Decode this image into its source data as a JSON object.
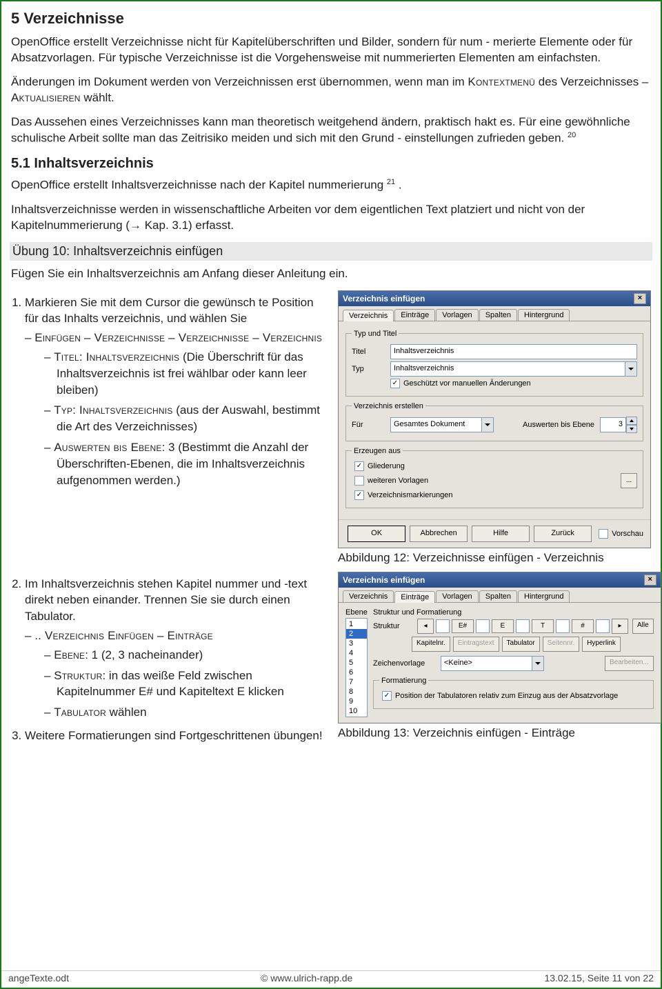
{
  "h1": "5    Verzeichnisse",
  "p1": "OpenOffice erstellt Verzeichnisse nicht für Kapitelüberschriften und Bilder, sondern für num - merierte Elemente oder für Absatzvorlagen. Für typische Verzeichnisse ist die Vorgehensweise mit nummerierten Elementen am einfachsten.",
  "p2a": "Änderungen im Dokument werden von Verzeichnissen erst übernommen, wenn man im ",
  "p2b": "Kontextmenü",
  "p2c": " des Verzeichnisses – ",
  "p2d": "Aktualisieren",
  "p2e": " wählt.",
  "p3": "Das Aussehen eines Verzeichnisses kann man theoretisch weitgehend ändern, praktisch hakt es. Für eine gewöhnliche schulische Arbeit sollte man das Zeitrisiko meiden und sich mit den Grund - einstellungen zufrieden geben.",
  "fn20": "20",
  "h2": "5.1   Inhaltsverzeichnis",
  "p4a": "OpenOffice erstellt Inhaltsverzeichnisse nach der Kapitel nummerierung",
  "fn21": "21",
  "p4b": ".",
  "p5": "Inhaltsverzeichnisse werden in wissenschaftliche Arbeiten vor dem eigentlichen Text platziert und nicht von der Kapitelnummerierung (→ Kap.  3.1) erfasst.",
  "exercise": "Übung 10: Inhaltsverzeichnis einfügen",
  "p6": "Fügen Sie ein Inhaltsverzeichnis am Anfang dieser Anleitung ein.",
  "li1": "Markieren Sie mit dem Cursor die gewünsch te Position für das Inhalts verzeichnis, und wählen Sie",
  "li1a_pre": "Einfügen – Verzeichnisse – Verzeichnisse – Verzeichnis",
  "li1a1_sc": "Titel: Inhaltsverzeichnis",
  "li1a1_rest": " (Die Überschrift für das Inhaltsverzeichnis ist frei wählbar oder kann leer bleiben)",
  "li1a2_sc": "Typ: Inhaltsverzeichnis",
  "li1a2_rest": " (aus der Auswahl, bestimmt die Art des Verzeichnisses)",
  "li1a3_sc": "Auswerten bis Ebene",
  "li1a3_rest": ": 3 (Bestimmt die Anzahl der Überschriften-Ebenen, die im Inhaltsverzeichnis aufgenommen werden.)",
  "caption1": "Abbildung 12: Verzeichnisse einfügen - Verzeichnis",
  "li2": "Im Inhaltsverzeichnis stehen Kapitel nummer und -text direkt neben einander. Trennen Sie sie durch einen Tabulator.",
  "li2a_pre": ".. Verzeichnis Einfügen – Einträge",
  "li2a1_sc": "Ebene",
  "li2a1_rest": ": 1 (2, 3 nacheinander)",
  "li2a2_sc": "Struktur",
  "li2a2_rest": ": in das weiße Feld zwischen Kapitelnummer E# und Kapiteltext E klicken",
  "li2a3_sc": "Tabulator",
  "li2a3_rest": " wählen",
  "li3": "Weitere Formatierungen sind Fortgeschrittenen übungen!",
  "caption2": "Abbildung 13: Verzeichnis einfügen - Einträge",
  "dlg": {
    "title": "Verzeichnis einfügen",
    "tabs": [
      "Verzeichnis",
      "Einträge",
      "Vorlagen",
      "Spalten",
      "Hintergrund"
    ],
    "grp1": "Typ und Titel",
    "lbl_titel": "Titel",
    "val_titel": "Inhaltsverzeichnis",
    "lbl_typ": "Typ",
    "val_typ": "Inhaltsverzeichnis",
    "chk_protect": "Geschützt vor manuellen Änderungen",
    "grp2": "Verzeichnis erstellen",
    "lbl_fuer": "Für",
    "val_fuer": "Gesamtes Dokument",
    "lbl_level": "Auswerten bis Ebene",
    "val_level": "3",
    "grp3": "Erzeugen aus",
    "chk_outline": "Gliederung",
    "chk_templates": "weiteren Vorlagen",
    "chk_marks": "Verzeichnismarkierungen",
    "btn_ok": "OK",
    "btn_cancel": "Abbrechen",
    "btn_help": "Hilfe",
    "btn_back": "Zurück",
    "chk_preview": "Vorschau"
  },
  "dlg2": {
    "title": "Verzeichnis einfügen",
    "tabs": [
      "Verzeichnis",
      "Einträge",
      "Vorlagen",
      "Spalten",
      "Hintergrund"
    ],
    "lbl_ebene": "Ebene",
    "lbl_struct": "Struktur und Formatierung",
    "lbl_struktur": "Struktur",
    "levels": [
      "1",
      "2",
      "3",
      "4",
      "5",
      "6",
      "7",
      "8",
      "9",
      "10"
    ],
    "sel_level": "2",
    "boxes": [
      "E#",
      "E",
      "T",
      "#"
    ],
    "btn_all": "Alle",
    "btns": [
      "Kapitelnr.",
      "Eintragstext",
      "Tabulator",
      "Seitennr.",
      "Hyperlink"
    ],
    "lbl_charstyle": "Zeichenvorlage",
    "val_charstyle": "<Keine>",
    "btn_edit": "Bearbeiten...",
    "grp_fmt": "Formatierung",
    "chk_tabpos": "Position der Tabulatoren relativ zum Einzug aus der Absatzvorlage"
  },
  "footer": {
    "left": "angeTexte.odt",
    "mid": "© www.ulrich-rapp.de",
    "right": "13.02.15, Seite 11 von 22"
  }
}
